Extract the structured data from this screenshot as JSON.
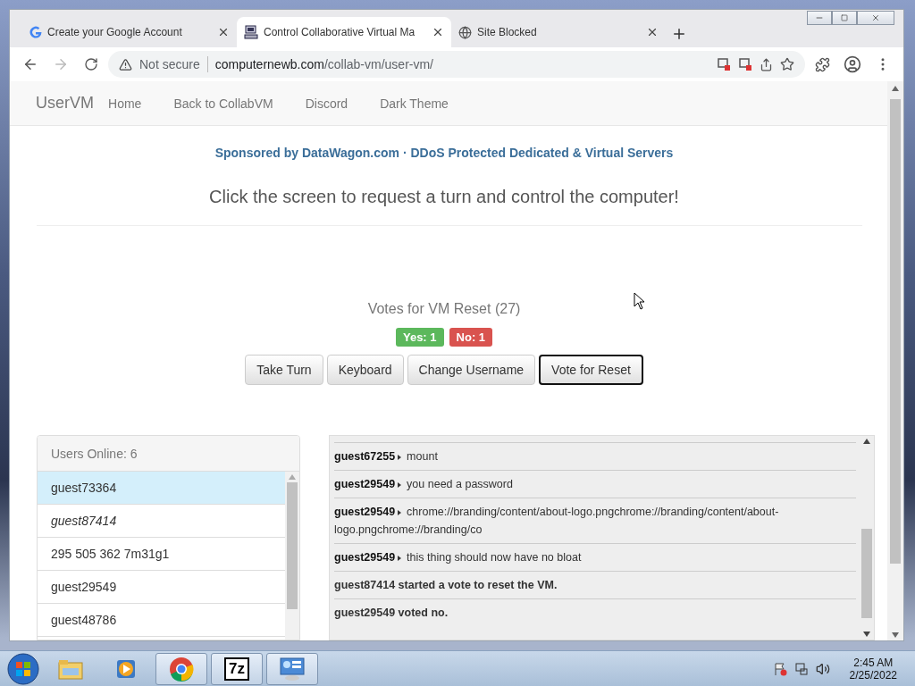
{
  "browser": {
    "tabs": [
      {
        "title": "Create your Google Account",
        "kind": "google",
        "selected": false
      },
      {
        "title": "Control Collaborative Virtual Ma",
        "kind": "computer",
        "selected": true
      },
      {
        "title": "Site Blocked",
        "kind": "globe",
        "selected": false
      }
    ],
    "nav_buttons": [
      {
        "kind": "back",
        "disabled": false
      },
      {
        "kind": "forward",
        "disabled": true
      },
      {
        "kind": "reload",
        "disabled": false
      }
    ],
    "address": {
      "security": "Not secure",
      "host": "computernewb.com",
      "path": "/collab-vm/user-vm/"
    }
  },
  "page": {
    "navbar": {
      "brand": "UserVM",
      "links": [
        "Home",
        "Back to CollabVM",
        "Discord",
        "Dark Theme"
      ]
    },
    "sponsor": "Sponsored by DataWagon.com · DDoS Protected Dedicated & Virtual Servers",
    "instruction": "Click the screen to request a turn and control the computer!",
    "vote": {
      "title": "Votes for VM Reset (27)",
      "yes": "Yes: 1",
      "no": "No: 1"
    },
    "buttons": [
      {
        "label": "Take Turn",
        "focused": false
      },
      {
        "label": "Keyboard",
        "focused": false
      },
      {
        "label": "Change Username",
        "focused": false
      },
      {
        "label": "Vote for Reset",
        "focused": true
      }
    ],
    "users": {
      "header": "Users Online: 6",
      "items": [
        {
          "name": "guest73364",
          "selected": true,
          "emphasized": false
        },
        {
          "name": "guest87414",
          "selected": false,
          "emphasized": true
        },
        {
          "name": "295 505 362 7m31g1",
          "selected": false,
          "emphasized": false
        },
        {
          "name": "guest29549",
          "selected": false,
          "emphasized": false
        },
        {
          "name": "guest48786",
          "selected": false,
          "emphasized": false
        }
      ]
    },
    "chat": [
      {
        "kind": "message",
        "user": "guest67255",
        "text": "mount"
      },
      {
        "kind": "message",
        "user": "guest29549",
        "text": "you need a password"
      },
      {
        "kind": "message",
        "user": "guest29549",
        "text": "chrome://branding/content/about-logo.pngchrome://branding/content/about-logo.pngchrome://branding/co"
      },
      {
        "kind": "message",
        "user": "guest29549",
        "text": "this thing should now have no bloat"
      },
      {
        "kind": "system",
        "text": "guest87414 started a vote to reset the VM."
      },
      {
        "kind": "system",
        "text": "guest29549 voted no."
      }
    ]
  },
  "taskbar": {
    "apps": [
      {
        "kind": "explorer",
        "active": false
      },
      {
        "kind": "media",
        "active": false
      },
      {
        "kind": "chrome",
        "active": true
      },
      {
        "kind": "archive",
        "label": "7z",
        "active": true
      },
      {
        "kind": "panel",
        "active": true
      }
    ],
    "time": "2:45 AM",
    "date": "2/25/2022"
  }
}
